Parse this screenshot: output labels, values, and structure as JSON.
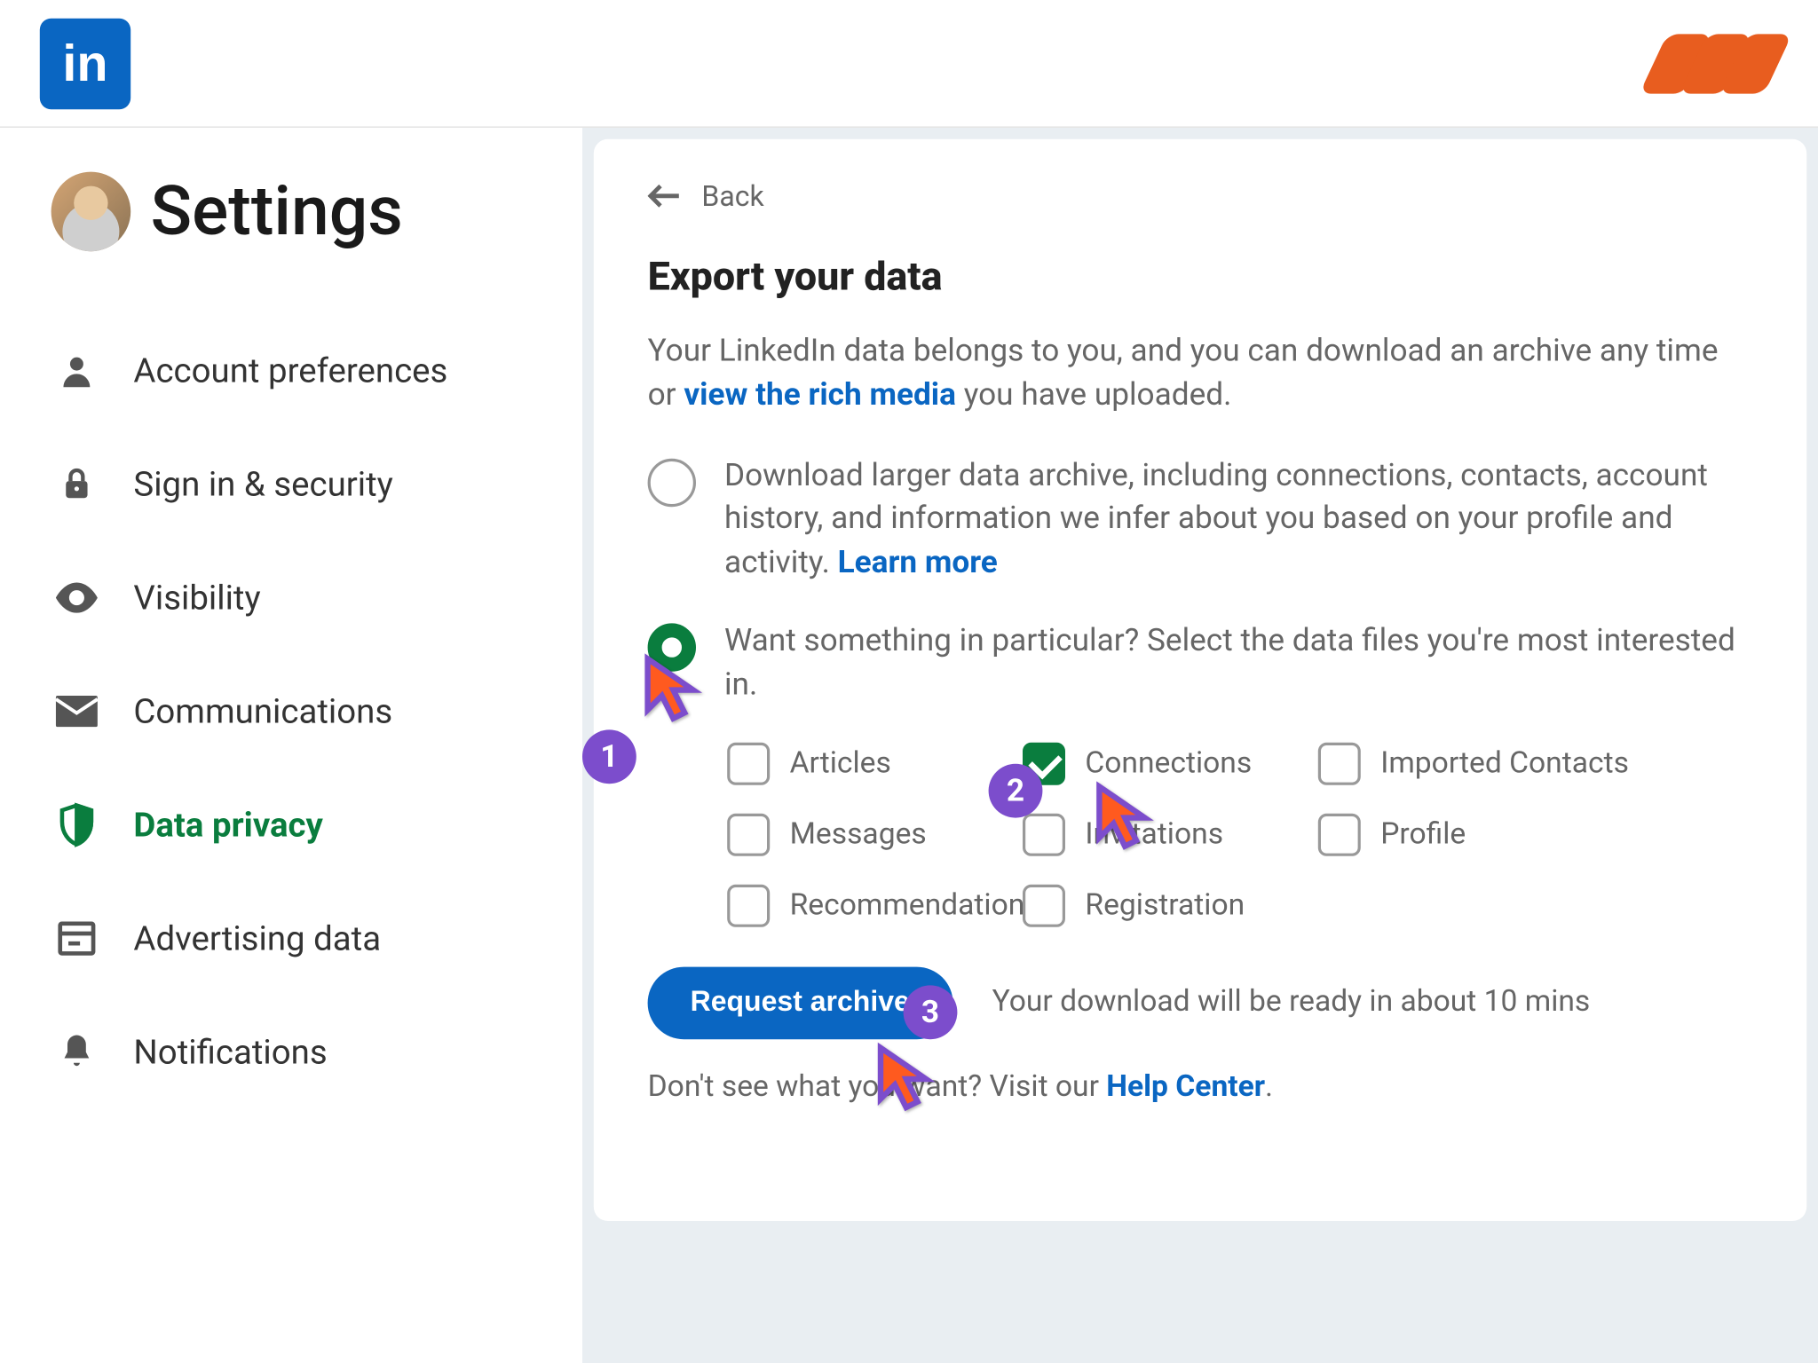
{
  "header": {
    "logo_text": "in"
  },
  "sidebar": {
    "title": "Settings",
    "items": [
      {
        "label": "Account preferences",
        "icon": "user-icon"
      },
      {
        "label": "Sign in & security",
        "icon": "lock-icon"
      },
      {
        "label": "Visibility",
        "icon": "eye-icon"
      },
      {
        "label": "Communications",
        "icon": "mail-icon"
      },
      {
        "label": "Data privacy",
        "icon": "shield-icon",
        "active": true
      },
      {
        "label": "Advertising data",
        "icon": "ad-icon"
      },
      {
        "label": "Notifications",
        "icon": "bell-icon"
      }
    ]
  },
  "main": {
    "back": "Back",
    "title": "Export your data",
    "desc_pre": "Your LinkedIn data belongs to you, and you can download an archive any time or ",
    "desc_link": "view the rich media",
    "desc_post": " you have uploaded.",
    "option1_pre": "Download larger data archive, including connections, contacts, account history, and information we infer about you based on your profile and activity. ",
    "option1_link": "Learn more",
    "option2": "Want something in particular? Select the data files you're most interested in.",
    "checkboxes": [
      {
        "label": "Articles",
        "checked": false
      },
      {
        "label": "Connections",
        "checked": true
      },
      {
        "label": "Imported Contacts",
        "checked": false
      },
      {
        "label": "Messages",
        "checked": false
      },
      {
        "label": "Invitations",
        "checked": false
      },
      {
        "label": "Profile",
        "checked": false
      },
      {
        "label": "Recommendations",
        "checked": false
      },
      {
        "label": "Registration",
        "checked": false
      }
    ],
    "button": "Request archive",
    "wait_note": "Your download will be ready in about 10 mins",
    "footer_pre": "Don't see what you want? Visit our ",
    "footer_link": "Help Center",
    "footer_post": "."
  },
  "annotations": {
    "step1": "1",
    "step2": "2",
    "step3": "3"
  }
}
